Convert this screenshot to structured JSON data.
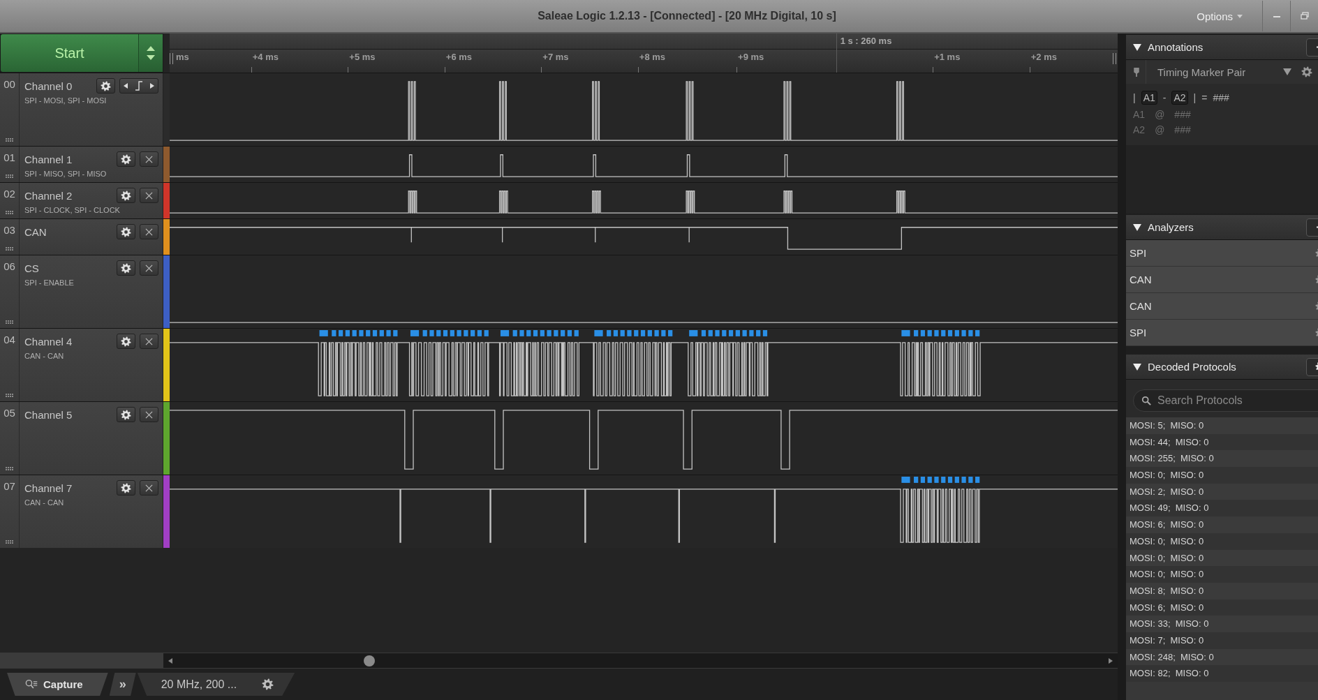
{
  "window": {
    "title": "Saleae Logic 1.2.13 - [Connected] - [20 MHz Digital, 10 s]",
    "options": "Options"
  },
  "start_button": "Start",
  "ruler": {
    "marker": "1 s : 260 ms",
    "ticks": [
      "ms",
      "+4 ms",
      "+5 ms",
      "+6 ms",
      "+7 ms",
      "+8 ms",
      "+9 ms",
      "+1 ms",
      "+2 ms"
    ]
  },
  "channels": [
    {
      "number": "00",
      "name": "Channel 0",
      "analyzers": "SPI - MOSI, SPI - MOSI",
      "color": "#2b2b2b",
      "trigger": true,
      "expanded": true,
      "kind": "spi_data"
    },
    {
      "number": "01",
      "name": "Channel 1",
      "analyzers": "SPI - MISO, SPI - MISO",
      "color": "#8e5a2e",
      "trigger": false,
      "expanded": false,
      "kind": "miso"
    },
    {
      "number": "02",
      "name": "Channel 2",
      "analyzers": "SPI - CLOCK, SPI - CLOCK",
      "color": "#d0352a",
      "trigger": false,
      "expanded": false,
      "kind": "clock"
    },
    {
      "number": "03",
      "name": "CAN",
      "color": "#e0901e",
      "trigger": false,
      "expanded": false,
      "kind": "can"
    },
    {
      "number": "06",
      "name": "CS",
      "analyzers": "SPI - ENABLE",
      "color": "#3d5fc4",
      "trigger": false,
      "expanded": true,
      "kind": "idle"
    },
    {
      "number": "04",
      "name": "Channel 4",
      "analyzers": "CAN - CAN",
      "color": "#e2c419",
      "trigger": false,
      "expanded": true,
      "kind": "can_bursts",
      "decoded": true
    },
    {
      "number": "05",
      "name": "Channel 5",
      "color": "#5ea62e",
      "trigger": false,
      "expanded": true,
      "kind": "enable"
    },
    {
      "number": "07",
      "name": "Channel 7",
      "analyzers": "CAN - CAN",
      "color": "#a13fc4",
      "trigger": false,
      "expanded": true,
      "kind": "spikes",
      "decoded": true
    }
  ],
  "bottom_bar": {
    "capture_tab": "Capture",
    "more": "»",
    "settings": "20 MHz, 200 ..."
  },
  "annotations": {
    "title": "Annotations",
    "marker_type": "Timing Marker Pair",
    "formula": {
      "bar": "|",
      "a1": "A1",
      "minus": "-",
      "a2": "A2",
      "bar_end": "|",
      "equals": "=",
      "value": "###"
    },
    "lines": [
      {
        "marker": "A1",
        "at": "@",
        "value": "###"
      },
      {
        "marker": "A2",
        "at": "@",
        "value": "###"
      }
    ]
  },
  "analyzers": {
    "title": "Analyzers",
    "items": [
      "SPI",
      "CAN",
      "CAN",
      "SPI"
    ]
  },
  "decoded_protocols": {
    "title": "Decoded Protocols",
    "search": {
      "placeholder": "Search Protocols"
    },
    "rows": [
      "MOSI: 5;  MISO: 0",
      "MOSI: 44;  MISO: 0",
      "MOSI: 255;  MISO: 0",
      "MOSI: 0;  MISO: 0",
      "MOSI: 2;  MISO: 0",
      "MOSI: 49;  MISO: 0",
      "MOSI: 6;  MISO: 0",
      "MOSI: 0;  MISO: 0",
      "MOSI: 0;  MISO: 0",
      "MOSI: 0;  MISO: 0",
      "MOSI: 8;  MISO: 0",
      "MOSI: 6;  MISO: 0",
      "MOSI: 33;  MISO: 0",
      "MOSI: 7;  MISO: 0",
      "MOSI: 248;  MISO: 0",
      "MOSI: 82;  MISO: 0"
    ]
  }
}
